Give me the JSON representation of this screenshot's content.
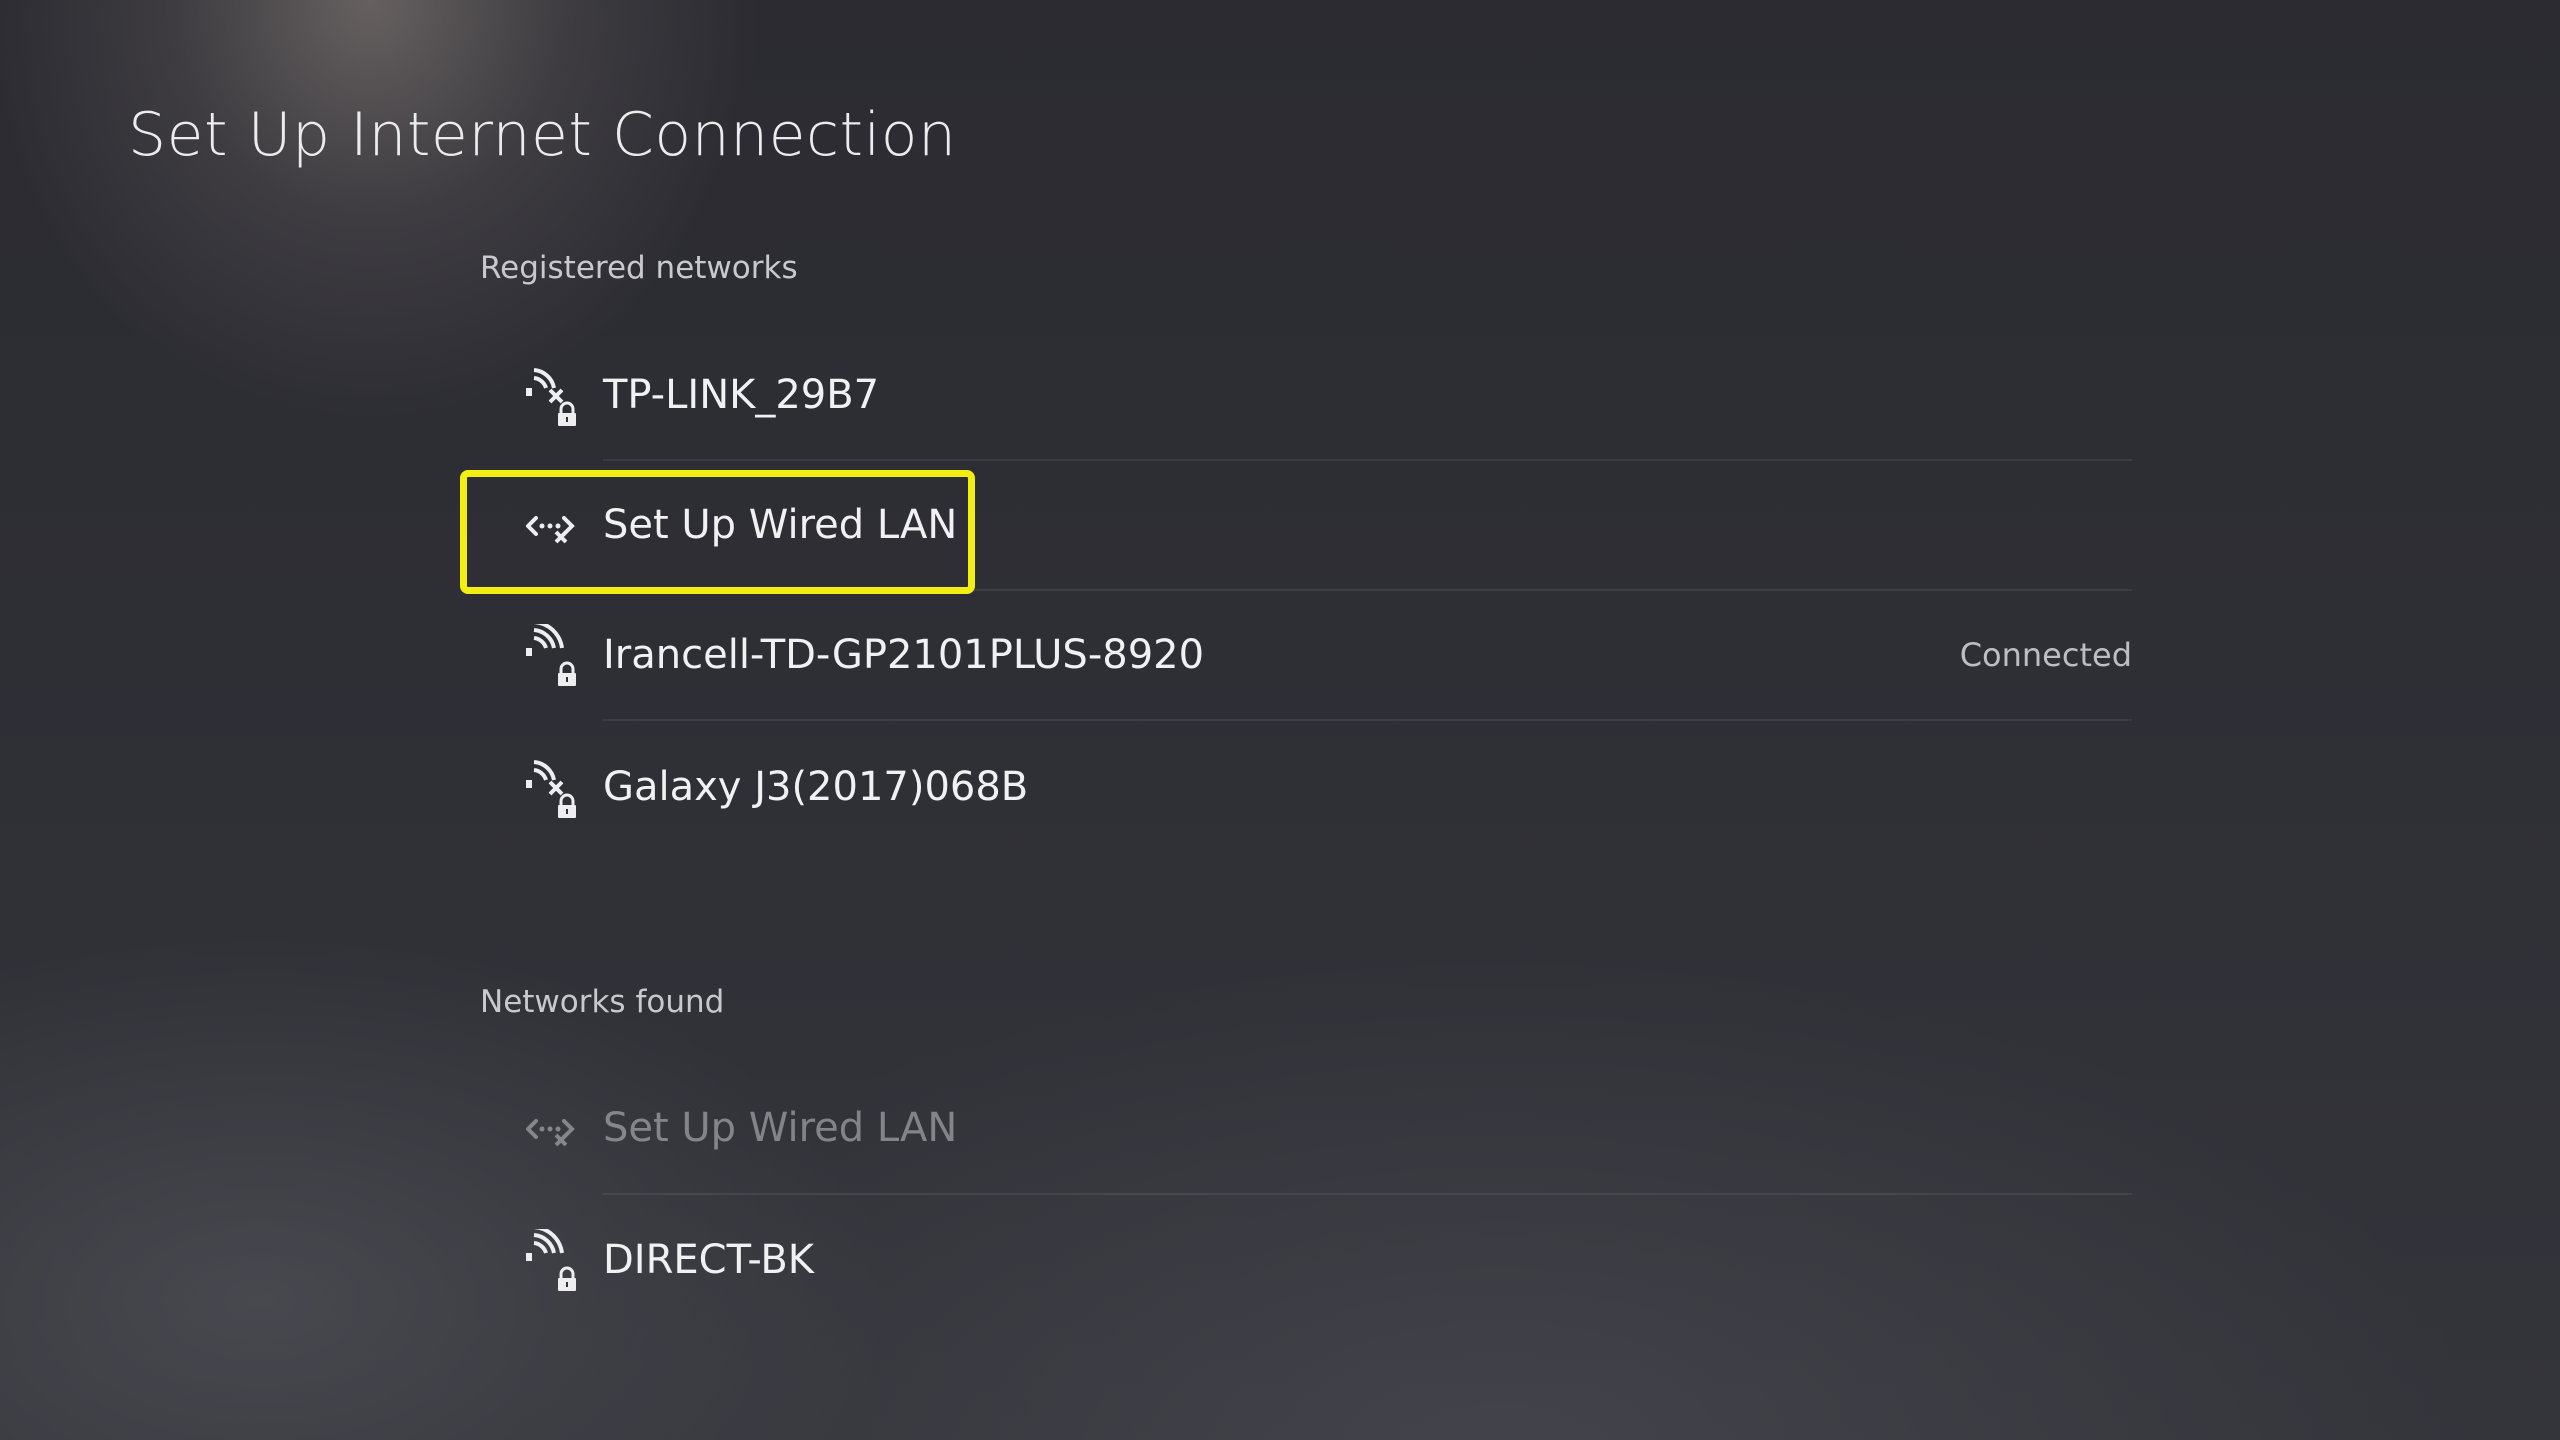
{
  "page": {
    "title": "Set Up Internet Connection"
  },
  "registered": {
    "heading": "Registered networks",
    "items": [
      {
        "label": "TP-LINK_29B7",
        "icon": "wifi-unavailable-locked-icon",
        "status": ""
      },
      {
        "label": "Set Up Wired LAN",
        "icon": "wired-lan-disconnected-icon",
        "status": ""
      },
      {
        "label": "Irancell-TD-GP2101PLUS-8920",
        "icon": "wifi-locked-icon",
        "status": "Connected"
      },
      {
        "label": "Galaxy J3(2017)068B",
        "icon": "wifi-unavailable-locked-icon",
        "status": ""
      }
    ]
  },
  "found": {
    "heading": "Networks found",
    "items": [
      {
        "label": "Set Up Wired LAN",
        "icon": "wired-lan-disconnected-icon",
        "status": ""
      },
      {
        "label": "DIRECT-BK",
        "icon": "wifi-locked-icon",
        "status": ""
      }
    ]
  },
  "colors": {
    "highlight": "#f2ee12",
    "text": "#f1f1f3",
    "status": "#bdbdc2"
  }
}
